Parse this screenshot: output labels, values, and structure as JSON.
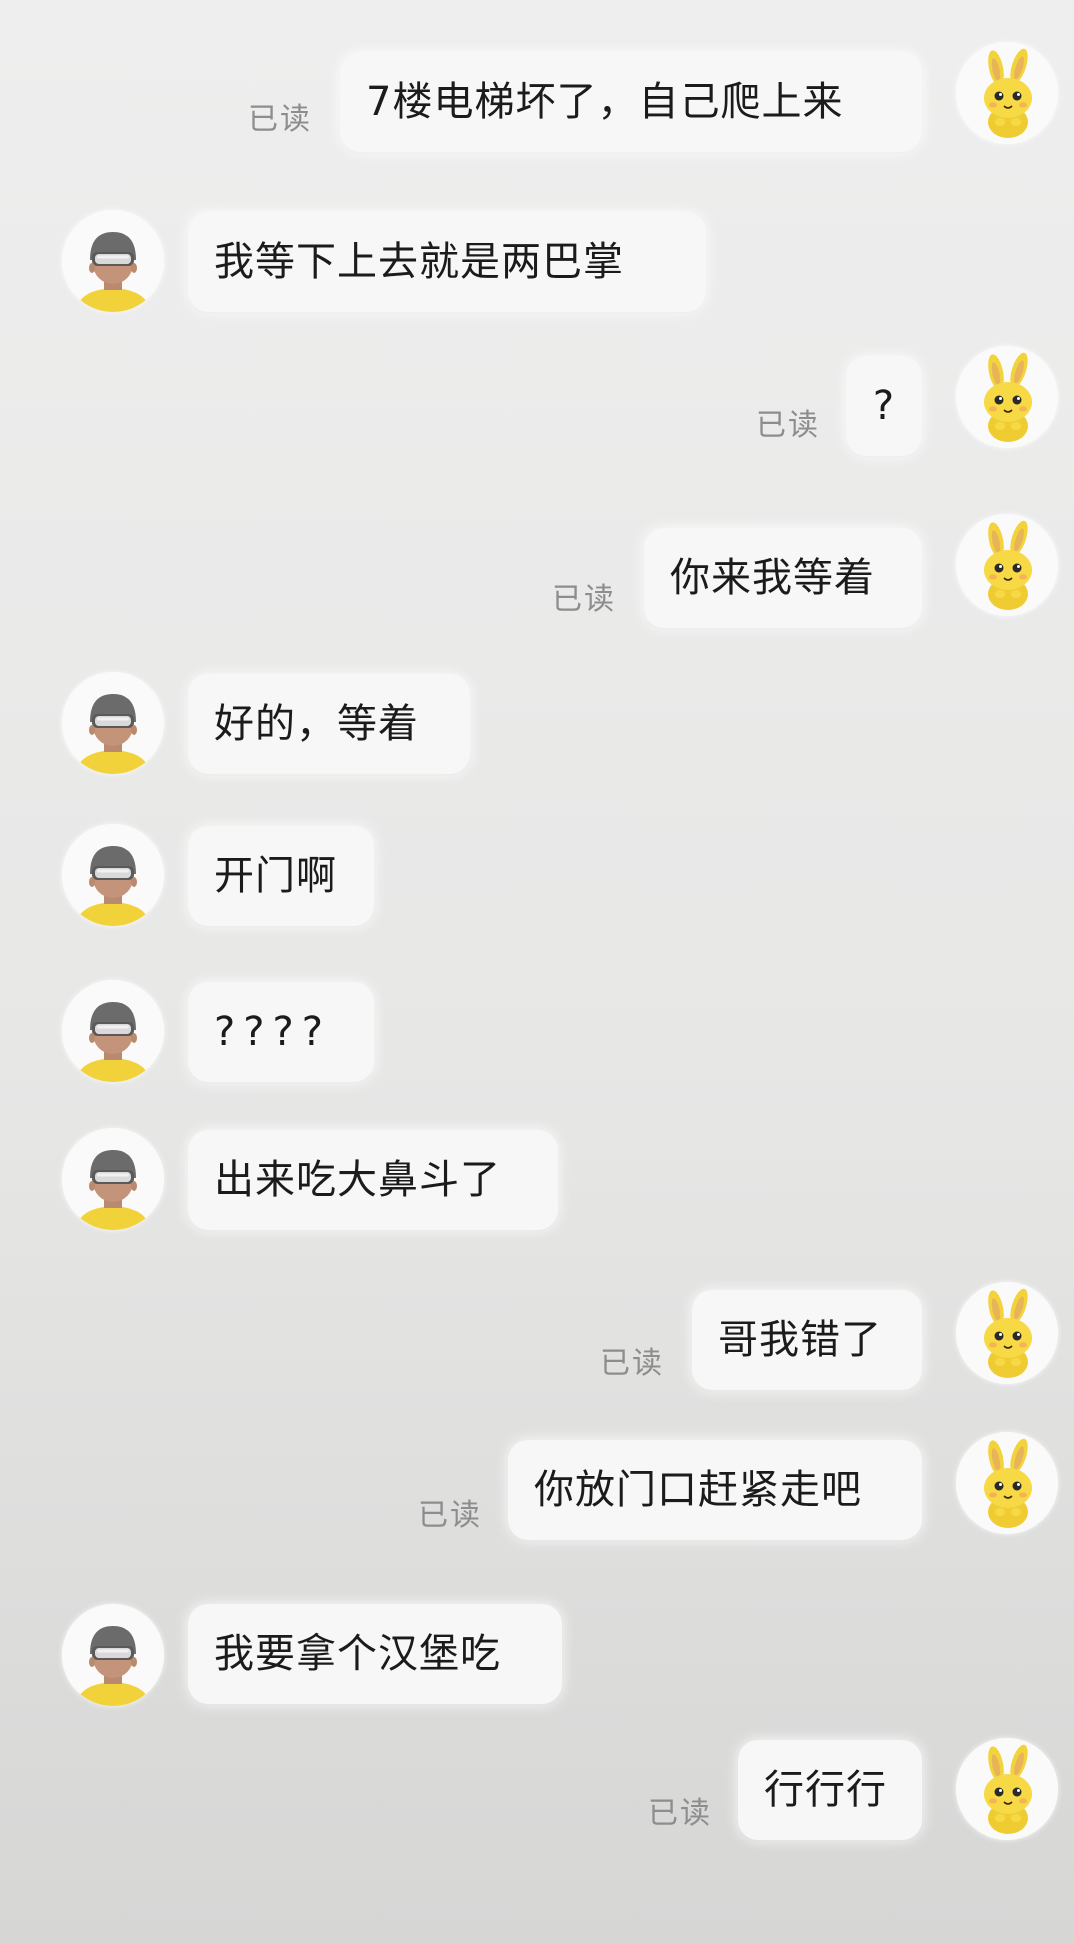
{
  "chat": {
    "read_label": "已读",
    "messages": [
      {
        "side": "right",
        "text": "7楼电梯坏了，自己爬上来",
        "status": "已读"
      },
      {
        "side": "left",
        "text": "我等下上去就是两巴掌"
      },
      {
        "side": "right",
        "text": "?",
        "status": "已读"
      },
      {
        "side": "right",
        "text": "你来我等着",
        "status": "已读"
      },
      {
        "side": "left",
        "text": "好的，等着"
      },
      {
        "side": "left",
        "text": "开门啊"
      },
      {
        "side": "left",
        "text": "????"
      },
      {
        "side": "left",
        "text": "出来吃大鼻斗了"
      },
      {
        "side": "right",
        "text": "哥我错了",
        "status": "已读"
      },
      {
        "side": "right",
        "text": "你放门口赶紧走吧",
        "status": "已读"
      },
      {
        "side": "left",
        "text": "我要拿个汉堡吃"
      },
      {
        "side": "right",
        "text": "行行行",
        "status": "已读"
      }
    ]
  },
  "avatars": {
    "self": "rabbit-avatar-icon",
    "other": "courier-helmet-avatar-icon"
  },
  "colors": {
    "background": "#ebebeb",
    "bubble": "#f7f7f7",
    "text": "#1b1b1b",
    "read_status": "#8d8d8d",
    "rabbit_yellow": "#f3d33c",
    "helmet_gray": "#6b6b6b",
    "shirt_yellow": "#f2d23b"
  }
}
